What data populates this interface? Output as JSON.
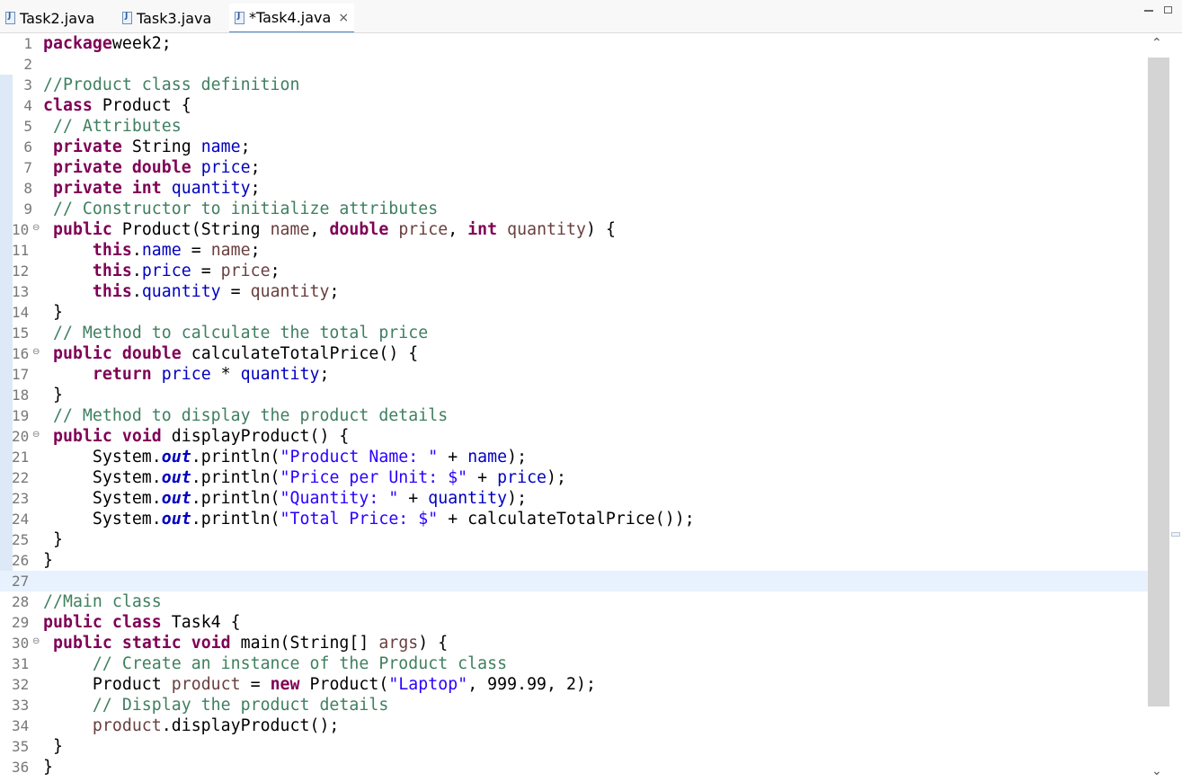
{
  "tabs": [
    {
      "label": "Task2.java",
      "active": false
    },
    {
      "label": "Task3.java",
      "active": false
    },
    {
      "label": "*Task4.java",
      "active": true
    }
  ],
  "tab_close_glyph": "×",
  "editor": {
    "lines": [
      {
        "n": "1",
        "fold": false,
        "tokens": [
          [
            "kw",
            "package"
          ],
          [
            "",
            "week2;"
          ]
        ]
      },
      {
        "n": "2",
        "fold": false,
        "tokens": []
      },
      {
        "n": "3",
        "fold": false,
        "tokens": [
          [
            "cm",
            "//Product class definition"
          ]
        ]
      },
      {
        "n": "4",
        "fold": false,
        "tokens": [
          [
            "kw",
            "class"
          ],
          [
            "",
            " Product {"
          ]
        ]
      },
      {
        "n": "5",
        "fold": false,
        "tokens": [
          [
            "",
            " "
          ],
          [
            "cm",
            "// Attributes"
          ]
        ]
      },
      {
        "n": "6",
        "fold": false,
        "tokens": [
          [
            "",
            " "
          ],
          [
            "kw",
            "private"
          ],
          [
            "",
            " String "
          ],
          [
            "fd",
            "name"
          ],
          [
            "",
            ";"
          ]
        ]
      },
      {
        "n": "7",
        "fold": false,
        "tokens": [
          [
            "",
            " "
          ],
          [
            "kw",
            "private"
          ],
          [
            "",
            " "
          ],
          [
            "kw",
            "double"
          ],
          [
            "",
            " "
          ],
          [
            "fd",
            "price"
          ],
          [
            "",
            ";"
          ]
        ]
      },
      {
        "n": "8",
        "fold": false,
        "tokens": [
          [
            "",
            " "
          ],
          [
            "kw",
            "private"
          ],
          [
            "",
            " "
          ],
          [
            "kw",
            "int"
          ],
          [
            "",
            " "
          ],
          [
            "fd",
            "quantity"
          ],
          [
            "",
            ";"
          ]
        ]
      },
      {
        "n": "9",
        "fold": false,
        "tokens": [
          [
            "",
            " "
          ],
          [
            "cm",
            "// Constructor to initialize attributes"
          ]
        ]
      },
      {
        "n": "10",
        "fold": true,
        "tokens": [
          [
            "",
            " "
          ],
          [
            "kw",
            "public"
          ],
          [
            "",
            " Product(String "
          ],
          [
            "lv",
            "name"
          ],
          [
            "",
            ", "
          ],
          [
            "kw",
            "double"
          ],
          [
            "",
            " "
          ],
          [
            "lv",
            "price"
          ],
          [
            "",
            ", "
          ],
          [
            "kw",
            "int"
          ],
          [
            "",
            " "
          ],
          [
            "lv",
            "quantity"
          ],
          [
            "",
            ") {"
          ]
        ]
      },
      {
        "n": "11",
        "fold": false,
        "tokens": [
          [
            "",
            "     "
          ],
          [
            "kw",
            "this"
          ],
          [
            "",
            "."
          ],
          [
            "fd",
            "name"
          ],
          [
            "",
            " = "
          ],
          [
            "lv",
            "name"
          ],
          [
            "",
            ";"
          ]
        ]
      },
      {
        "n": "12",
        "fold": false,
        "tokens": [
          [
            "",
            "     "
          ],
          [
            "kw",
            "this"
          ],
          [
            "",
            "."
          ],
          [
            "fd",
            "price"
          ],
          [
            "",
            " = "
          ],
          [
            "lv",
            "price"
          ],
          [
            "",
            ";"
          ]
        ]
      },
      {
        "n": "13",
        "fold": false,
        "tokens": [
          [
            "",
            "     "
          ],
          [
            "kw",
            "this"
          ],
          [
            "",
            "."
          ],
          [
            "fd",
            "quantity"
          ],
          [
            "",
            " = "
          ],
          [
            "lv",
            "quantity"
          ],
          [
            "",
            ";"
          ]
        ]
      },
      {
        "n": "14",
        "fold": false,
        "tokens": [
          [
            "",
            " }"
          ]
        ]
      },
      {
        "n": "15",
        "fold": false,
        "tokens": [
          [
            "",
            " "
          ],
          [
            "cm",
            "// Method to calculate the total price"
          ]
        ]
      },
      {
        "n": "16",
        "fold": true,
        "tokens": [
          [
            "",
            " "
          ],
          [
            "kw",
            "public"
          ],
          [
            "",
            " "
          ],
          [
            "kw",
            "double"
          ],
          [
            "",
            " calculateTotalPrice() {"
          ]
        ]
      },
      {
        "n": "17",
        "fold": false,
        "tokens": [
          [
            "",
            "     "
          ],
          [
            "kw",
            "return"
          ],
          [
            "",
            " "
          ],
          [
            "fd",
            "price"
          ],
          [
            "",
            " * "
          ],
          [
            "fd",
            "quantity"
          ],
          [
            "",
            ";"
          ]
        ]
      },
      {
        "n": "18",
        "fold": false,
        "tokens": [
          [
            "",
            " }"
          ]
        ]
      },
      {
        "n": "19",
        "fold": false,
        "tokens": [
          [
            "",
            " "
          ],
          [
            "cm",
            "// Method to display the product details"
          ]
        ]
      },
      {
        "n": "20",
        "fold": true,
        "tokens": [
          [
            "",
            " "
          ],
          [
            "kw",
            "public"
          ],
          [
            "",
            " "
          ],
          [
            "kw",
            "void"
          ],
          [
            "",
            " displayProduct() {"
          ]
        ]
      },
      {
        "n": "21",
        "fold": false,
        "tokens": [
          [
            "",
            "     System."
          ],
          [
            "it",
            "out"
          ],
          [
            "",
            ".println("
          ],
          [
            "st",
            "\"Product Name: \""
          ],
          [
            "",
            " + "
          ],
          [
            "fd",
            "name"
          ],
          [
            "",
            ");"
          ]
        ]
      },
      {
        "n": "22",
        "fold": false,
        "tokens": [
          [
            "",
            "     System."
          ],
          [
            "it",
            "out"
          ],
          [
            "",
            ".println("
          ],
          [
            "st",
            "\"Price per Unit: $\""
          ],
          [
            "",
            " + "
          ],
          [
            "fd",
            "price"
          ],
          [
            "",
            ");"
          ]
        ]
      },
      {
        "n": "23",
        "fold": false,
        "tokens": [
          [
            "",
            "     System."
          ],
          [
            "it",
            "out"
          ],
          [
            "",
            ".println("
          ],
          [
            "st",
            "\"Quantity: \""
          ],
          [
            "",
            " + "
          ],
          [
            "fd",
            "quantity"
          ],
          [
            "",
            ");"
          ]
        ]
      },
      {
        "n": "24",
        "fold": false,
        "tokens": [
          [
            "",
            "     System."
          ],
          [
            "it",
            "out"
          ],
          [
            "",
            ".println("
          ],
          [
            "st",
            "\"Total Price: $\""
          ],
          [
            "",
            " + calculateTotalPrice());"
          ]
        ]
      },
      {
        "n": "25",
        "fold": false,
        "tokens": [
          [
            "",
            " }"
          ]
        ]
      },
      {
        "n": "26",
        "fold": false,
        "tokens": [
          [
            "",
            "}"
          ]
        ]
      },
      {
        "n": "27",
        "fold": false,
        "current": true,
        "tokens": []
      },
      {
        "n": "28",
        "fold": false,
        "tokens": [
          [
            "cm",
            "//Main class"
          ]
        ]
      },
      {
        "n": "29",
        "fold": false,
        "tokens": [
          [
            "kw",
            "public"
          ],
          [
            "",
            " "
          ],
          [
            "kw",
            "class"
          ],
          [
            "",
            " Task4 {"
          ]
        ]
      },
      {
        "n": "30",
        "fold": true,
        "tokens": [
          [
            "",
            " "
          ],
          [
            "kw",
            "public"
          ],
          [
            "",
            " "
          ],
          [
            "kw",
            "static"
          ],
          [
            "",
            " "
          ],
          [
            "kw",
            "void"
          ],
          [
            "",
            " main(String[] "
          ],
          [
            "lv",
            "args"
          ],
          [
            "",
            ") {"
          ]
        ]
      },
      {
        "n": "31",
        "fold": false,
        "tokens": [
          [
            "",
            "     "
          ],
          [
            "cm",
            "// Create an instance of the Product class"
          ]
        ]
      },
      {
        "n": "32",
        "fold": false,
        "tokens": [
          [
            "",
            "     Product "
          ],
          [
            "lv",
            "product"
          ],
          [
            "",
            " = "
          ],
          [
            "kw",
            "new"
          ],
          [
            "",
            " Product("
          ],
          [
            "st",
            "\"Laptop\""
          ],
          [
            "",
            ", 999.99, 2);"
          ]
        ]
      },
      {
        "n": "33",
        "fold": false,
        "tokens": [
          [
            "",
            "     "
          ],
          [
            "cm",
            "// Display the product details"
          ]
        ]
      },
      {
        "n": "34",
        "fold": false,
        "tokens": [
          [
            "",
            "     "
          ],
          [
            "lv",
            "product"
          ],
          [
            "",
            ".displayProduct();"
          ]
        ]
      },
      {
        "n": "35",
        "fold": false,
        "tokens": [
          [
            "",
            " }"
          ]
        ]
      },
      {
        "n": "36",
        "fold": false,
        "tokens": [
          [
            "",
            "}"
          ]
        ]
      }
    ]
  },
  "scrollbar": {
    "up_glyph": "⌃",
    "down_glyph": "⌄"
  }
}
